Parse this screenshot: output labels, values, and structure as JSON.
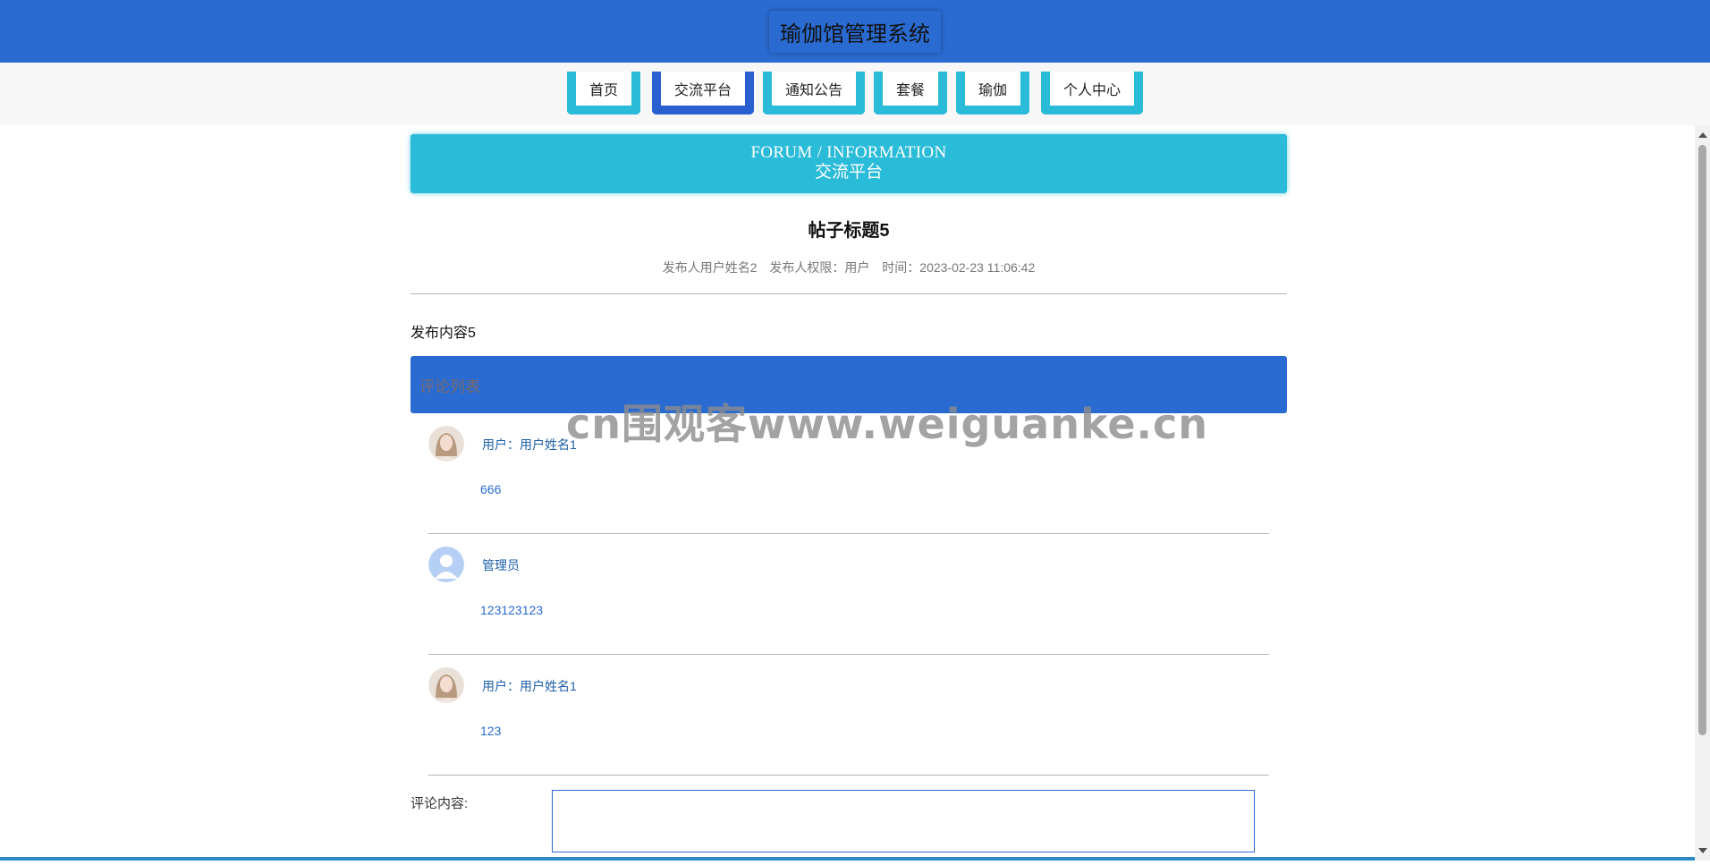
{
  "header": {
    "title": "瑜伽馆管理系统"
  },
  "nav": {
    "items": [
      {
        "label": "首页"
      },
      {
        "label": "交流平台"
      },
      {
        "label": "通知公告"
      },
      {
        "label": "套餐"
      },
      {
        "label": "瑜伽"
      },
      {
        "label": "个人中心"
      }
    ],
    "active": "交流平台"
  },
  "section": {
    "title_en": "FORUM / INFORMATION",
    "title_cn": "交流平台"
  },
  "post": {
    "title": "帖子标题5",
    "author": "发布人用户姓名2",
    "role": "发布人权限：用户",
    "time": "时间：2023-02-23 11:06:42",
    "content": "发布内容5"
  },
  "comments": {
    "header": "评论列表",
    "items": [
      {
        "user": "用户：用户姓名1",
        "text": "666",
        "avatar": "user-photo-avatar"
      },
      {
        "user": "管理员",
        "text": "123123123",
        "avatar": "default-user-icon"
      },
      {
        "user": "用户：用户姓名1",
        "text": "123",
        "avatar": "user-photo-avatar"
      }
    ]
  },
  "form": {
    "label": "评论内容:",
    "value": ""
  },
  "watermark": "cn围观客www.weiguanke.cn",
  "colors": {
    "primary": "#2a6bd1",
    "accent": "#2abbd9",
    "nav_bg": "#f7f7f7"
  }
}
